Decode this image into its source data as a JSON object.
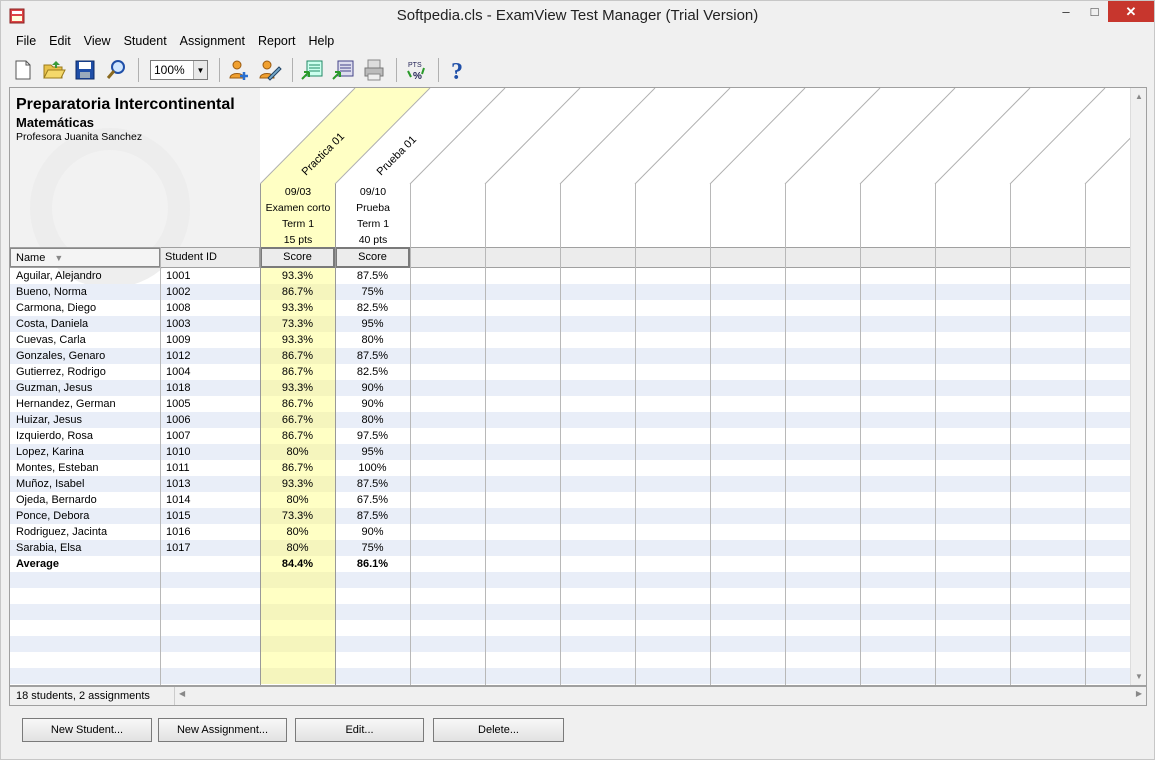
{
  "window": {
    "title": "Softpedia.cls - ExamView Test Manager (Trial Version)"
  },
  "menu": [
    "File",
    "Edit",
    "View",
    "Student",
    "Assignment",
    "Report",
    "Help"
  ],
  "toolbar": {
    "zoom": "100%"
  },
  "header": {
    "school": "Preparatoria Intercontinental",
    "subject": "Matemáticas",
    "teacher": "Profesora Juanita Sanchez"
  },
  "assignments": [
    {
      "name": "Practica 01",
      "date": "09/03",
      "type": "Examen corto",
      "term": "Term 1",
      "points": "15 pts",
      "col_label": "Score"
    },
    {
      "name": "Prueba 01",
      "date": "09/10",
      "type": "Prueba",
      "term": "Term 1",
      "points": "40 pts",
      "col_label": "Score"
    }
  ],
  "columns": {
    "name": "Name",
    "student_id": "Student ID"
  },
  "students": [
    {
      "name": "Aguilar, Alejandro",
      "id": "1001",
      "s1": "93.3%",
      "s2": "87.5%"
    },
    {
      "name": "Bueno, Norma",
      "id": "1002",
      "s1": "86.7%",
      "s2": "75%"
    },
    {
      "name": "Carmona, Diego",
      "id": "1008",
      "s1": "93.3%",
      "s2": "82.5%"
    },
    {
      "name": "Costa, Daniela",
      "id": "1003",
      "s1": "73.3%",
      "s2": "95%"
    },
    {
      "name": "Cuevas, Carla",
      "id": "1009",
      "s1": "93.3%",
      "s2": "80%"
    },
    {
      "name": "Gonzales, Genaro",
      "id": "1012",
      "s1": "86.7%",
      "s2": "87.5%"
    },
    {
      "name": "Gutierrez, Rodrigo",
      "id": "1004",
      "s1": "86.7%",
      "s2": "82.5%"
    },
    {
      "name": "Guzman, Jesus",
      "id": "1018",
      "s1": "93.3%",
      "s2": "90%"
    },
    {
      "name": "Hernandez, German",
      "id": "1005",
      "s1": "86.7%",
      "s2": "90%"
    },
    {
      "name": "Huizar, Jesus",
      "id": "1006",
      "s1": "66.7%",
      "s2": "80%"
    },
    {
      "name": "Izquierdo, Rosa",
      "id": "1007",
      "s1": "86.7%",
      "s2": "97.5%"
    },
    {
      "name": "Lopez, Karina",
      "id": "1010",
      "s1": "80%",
      "s2": "95%"
    },
    {
      "name": "Montes, Esteban",
      "id": "1011",
      "s1": "86.7%",
      "s2": "100%"
    },
    {
      "name": "Muñoz, Isabel",
      "id": "1013",
      "s1": "93.3%",
      "s2": "87.5%"
    },
    {
      "name": "Ojeda, Bernardo",
      "id": "1014",
      "s1": "80%",
      "s2": "67.5%"
    },
    {
      "name": "Ponce, Debora",
      "id": "1015",
      "s1": "73.3%",
      "s2": "87.5%"
    },
    {
      "name": "Rodriguez, Jacinta",
      "id": "1016",
      "s1": "80%",
      "s2": "90%"
    },
    {
      "name": "Sarabia, Elsa",
      "id": "1017",
      "s1": "80%",
      "s2": "75%"
    }
  ],
  "average": {
    "label": "Average",
    "s1": "84.4%",
    "s2": "86.1%"
  },
  "status": "18 students, 2 assignments",
  "buttons": {
    "new_student": "New Student...",
    "new_assignment": "New Assignment...",
    "edit": "Edit...",
    "delete": "Delete..."
  },
  "colors": {
    "highlight_col": "#ffffc4",
    "row_alt": "#e9eef8",
    "close": "#c7362d"
  }
}
